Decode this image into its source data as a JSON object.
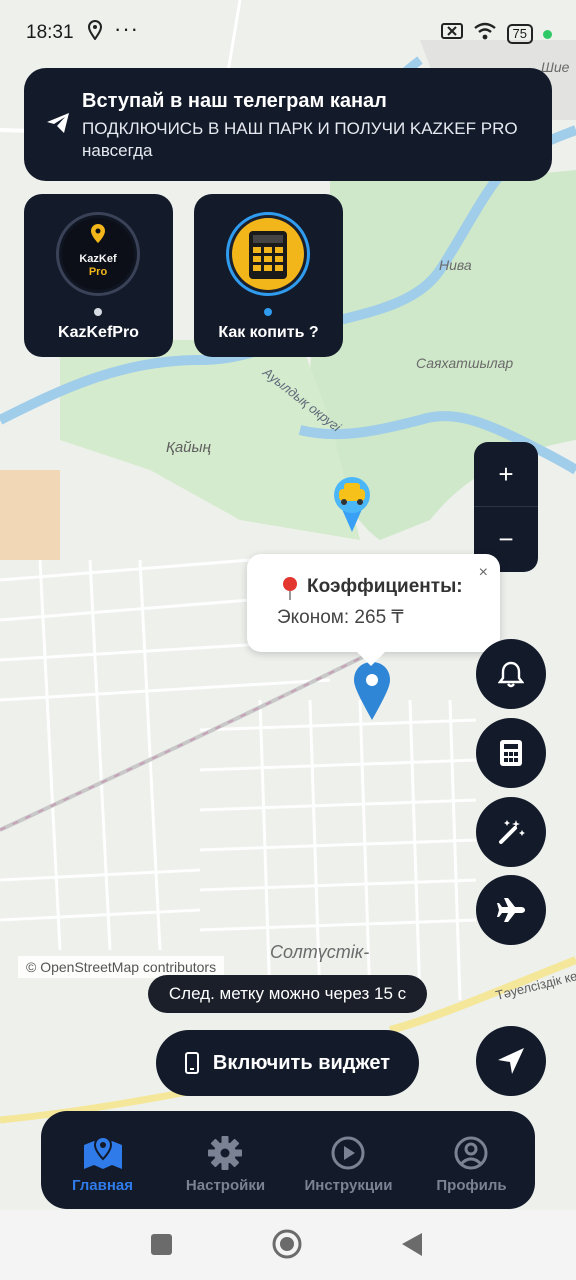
{
  "status": {
    "time": "18:31",
    "battery": "75"
  },
  "banner": {
    "title": "Вступай в наш телеграм канал",
    "subtitle": "ПОДКЛЮЧИСЬ В НАШ ПАРК И ПОЛУЧИ KAZKEF PRO навсегда"
  },
  "stories": [
    {
      "label": "KazKefPro",
      "logo_line1": "KazKef",
      "logo_line2": "Pro",
      "indicator_color": "#d7dbe3"
    },
    {
      "label": "Как копить ?",
      "indicator_color": "#2f9cf0"
    }
  ],
  "map": {
    "labels": {
      "niva": "Нива",
      "sayahatshylar": "Саяхатшылар",
      "kaiyn": "Қайың",
      "auyl": "Ауылдық округі",
      "soltustik": "Солтүстік-",
      "tauelsizdik": "Тәуелсіздік көш",
      "top_right": "Шие"
    },
    "attribution": "© OpenStreetMap contributors"
  },
  "zoom": {
    "plus": "+",
    "minus": "−"
  },
  "popup": {
    "title": "Коэффициенты:",
    "line": "Эконом: 265 ₸",
    "close": "×"
  },
  "toast": "След. метку можно через 15 с",
  "widget_button": "Включить виджет",
  "nav": [
    {
      "label": "Главная",
      "icon": "map-icon",
      "active": true
    },
    {
      "label": "Настройки",
      "icon": "gear-icon"
    },
    {
      "label": "Инструкции",
      "icon": "play-icon"
    },
    {
      "label": "Профиль",
      "icon": "user-icon"
    }
  ],
  "colors": {
    "accent": "#2f7bea",
    "panel": "#131a2a",
    "pin": "#2f86d6"
  }
}
